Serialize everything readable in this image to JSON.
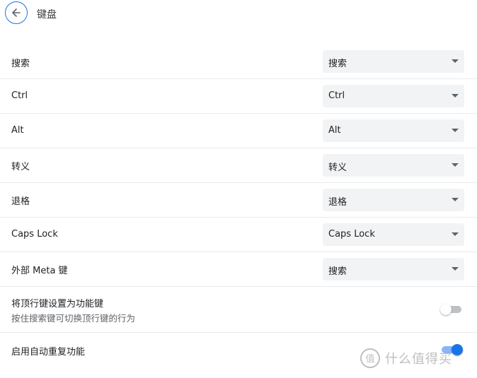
{
  "header": {
    "title": "键盘",
    "back_icon": "arrow-left-icon"
  },
  "rows": [
    {
      "label": "搜索",
      "value": "搜索"
    },
    {
      "label": "Ctrl",
      "value": "Ctrl"
    },
    {
      "label": "Alt",
      "value": "Alt"
    },
    {
      "label": "转义",
      "value": "转义"
    },
    {
      "label": "退格",
      "value": "退格"
    },
    {
      "label": "Caps Lock",
      "value": "Caps Lock"
    },
    {
      "label": "外部 Meta 键",
      "value": "搜索"
    }
  ],
  "function_keys": {
    "label": "将顶行键设置为功能键",
    "sublabel": "按住搜索键可切换顶行键的行为",
    "enabled": false
  },
  "auto_repeat": {
    "label": "启用自动重复功能",
    "enabled": true
  },
  "watermark": {
    "text": "什么值得买",
    "icon": "smzdm-logo-icon"
  },
  "colors": {
    "accent": "#1a73e8",
    "select_bg": "#f1f3f4",
    "divider": "#e8eaed"
  }
}
